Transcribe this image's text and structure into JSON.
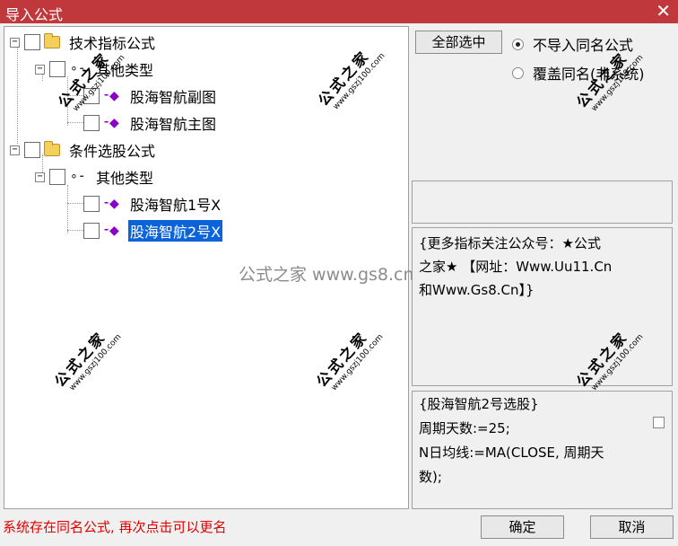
{
  "window": {
    "title": "导入公式",
    "close_glyph": "✕"
  },
  "tree": {
    "nodes": [
      {
        "label": "技术指标公式",
        "expander": "−"
      },
      {
        "label": "其他类型",
        "expander": "−"
      },
      {
        "label": "股海智航副图"
      },
      {
        "label": "股海智航主图"
      },
      {
        "label": "条件选股公式",
        "expander": "−"
      },
      {
        "label": "其他类型",
        "expander": "−"
      },
      {
        "label": "股海智航1号X"
      },
      {
        "label": "股海智航2号X",
        "selected": true
      }
    ]
  },
  "buttons": {
    "select_all": "全部选中",
    "confirm": "确定",
    "cancel": "取消"
  },
  "options": {
    "no_import_same_name": {
      "label": "不导入同名公式",
      "checked": true
    },
    "overwrite_same_name": {
      "label": "覆盖同名(非系统)",
      "checked": false
    }
  },
  "description": {
    "line1": "{更多指标关注公众号：★公式",
    "line2": "之家★ 【网址：Www.Uu11.Cn",
    "line3": "和Www.Gs8.Cn】}"
  },
  "formula_preview": {
    "line1": "{股海智航2号选股}",
    "line2": "周期天数:=25;",
    "line3": "N日均线:=MA(CLOSE, 周期天",
    "line4": "数);"
  },
  "status_message": "系统存在同名公式, 再次点击可以更名",
  "watermarks": {
    "brand": "公式之家",
    "url": "www.gszj100.com",
    "center_text": "公式之家 www.gs8.cn"
  },
  "colors": {
    "titlebar": "#c0383c",
    "selection": "#0a63d8",
    "status_text": "#e00000",
    "gem": "#8b00c8"
  }
}
